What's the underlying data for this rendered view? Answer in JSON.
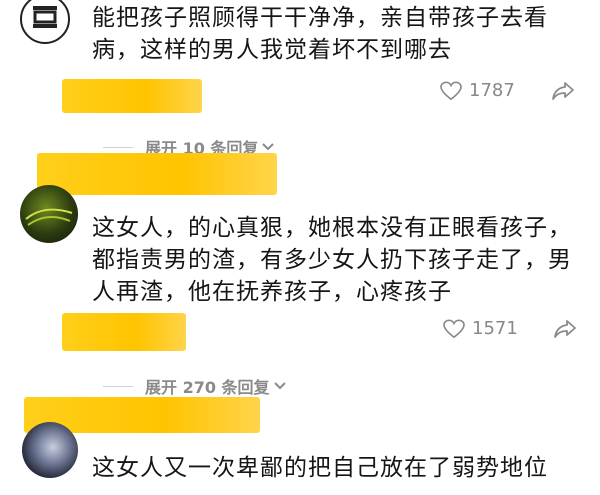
{
  "comments": [
    {
      "text_line1": "能把孩子照顾得干干净净，亲自带孩子去看",
      "text_line2": "病，这样的男人我觉着坏不到哪去",
      "likes": "1787",
      "expand_label": "展开 10 条回复"
    },
    {
      "text_line1": "这女人，的心真狠，她根本没有正眼看孩子，",
      "text_line2": "都指责男的渣，有多少女人扔下孩子走了，男",
      "text_line3": "人再渣，他在抚养孩子，心疼孩子",
      "likes": "1571",
      "expand_label": "展开 270 条回复"
    },
    {
      "text_line1": "这女人又一次卑鄙的把自己放在了弱势地位"
    }
  ],
  "colors": {
    "redaction": "#ffc400",
    "meta_text": "#888888",
    "body_text": "#161616"
  },
  "icons": [
    "avatar-emblem-icon",
    "heart-icon",
    "share-icon",
    "chevron-down-icon"
  ]
}
